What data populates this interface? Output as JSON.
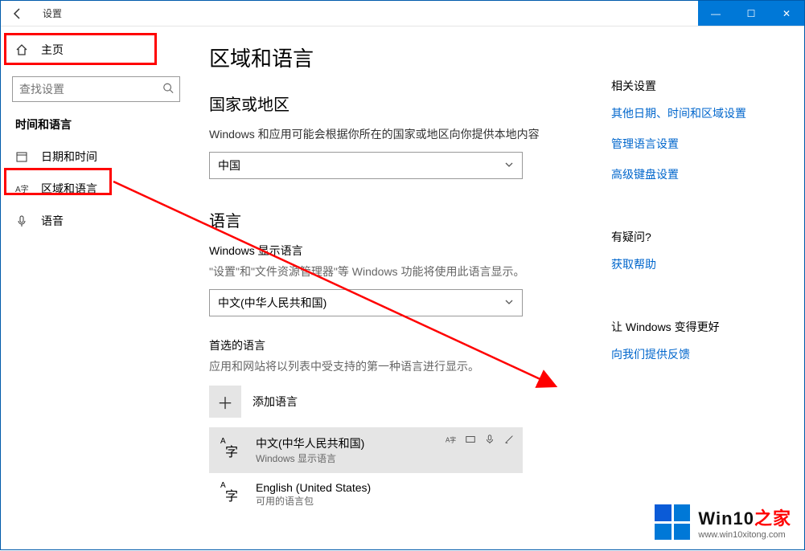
{
  "window": {
    "title": "设置",
    "controls": {
      "min": "—",
      "max": "☐",
      "close": "✕"
    }
  },
  "sidebar": {
    "home": "主页",
    "searchPlaceholder": "查找设置",
    "groupTitle": "时间和语言",
    "items": [
      {
        "label": "日期和时间"
      },
      {
        "label": "区域和语言"
      },
      {
        "label": "语音"
      }
    ]
  },
  "page": {
    "title": "区域和语言",
    "region": {
      "heading": "国家或地区",
      "desc": "Windows 和应用可能会根据你所在的国家或地区向你提供本地内容",
      "value": "中国"
    },
    "language": {
      "heading": "语言",
      "displayLabel": "Windows 显示语言",
      "displayDesc": "\"设置\"和\"文件资源管理器\"等 Windows 功能将使用此语言显示。",
      "displayValue": "中文(中华人民共和国)",
      "preferredLabel": "首选的语言",
      "preferredDesc": "应用和网站将以列表中受支持的第一种语言进行显示。",
      "addLabel": "添加语言",
      "items": [
        {
          "name": "中文(中华人民共和国)",
          "sub": "Windows 显示语言"
        },
        {
          "name": "English (United States)",
          "sub": "可用的语言包"
        }
      ]
    }
  },
  "right": {
    "relatedHeading": "相关设置",
    "links": [
      "其他日期、时间和区域设置",
      "管理语言设置",
      "高级键盘设置"
    ],
    "questionHeading": "有疑问?",
    "help": "获取帮助",
    "betterHeading": "让 Windows 变得更好",
    "feedback": "向我们提供反馈"
  },
  "watermark": {
    "brand_a": "Win10",
    "brand_b": "之家",
    "url": "www.win10xitong.com"
  }
}
